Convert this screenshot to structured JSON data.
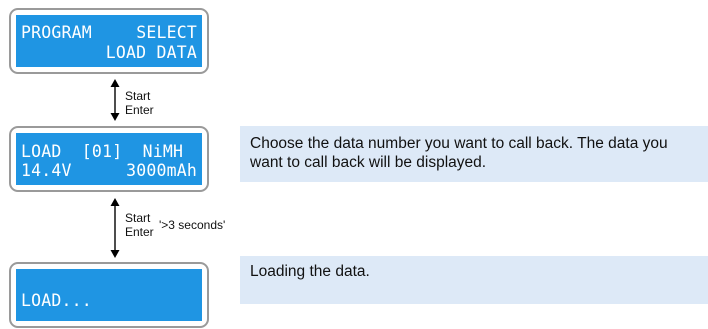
{
  "screens": [
    {
      "line1_left": "PROGRAM",
      "line1_right": "SELECT",
      "line2_right": "LOAD DATA"
    },
    {
      "line1": "LOAD  [01]  NiMH",
      "line2_left": "14.4V",
      "line2_right": "3000mAh"
    },
    {
      "line1": "LOAD..."
    }
  ],
  "transitions": [
    {
      "start": "Start",
      "enter": "Enter"
    },
    {
      "start": "Start",
      "enter": "Enter",
      "note": "'>3 seconds'"
    }
  ],
  "notes": [
    "Choose the data number you want to call back. The data you want to call back will be displayed.",
    "Loading the data."
  ],
  "colors": {
    "lcd": "#1f95e3",
    "note_bg": "#dde9f7",
    "frame": "#9a9a9a"
  }
}
